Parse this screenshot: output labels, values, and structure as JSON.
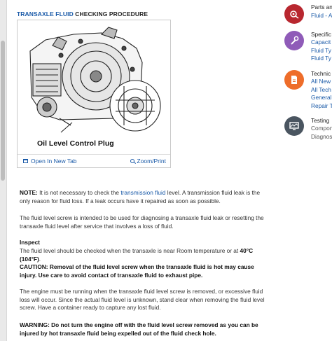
{
  "procedure": {
    "title_link": "TRANSAXLE FLUID",
    "title_rest": " CHECKING PROCEDURE"
  },
  "figure": {
    "caption": "Oil Level Control Plug",
    "open_label": "Open In New Tab",
    "zoom_label": "Zoom/Print"
  },
  "content": {
    "note_label": "NOTE:",
    "note_pre": " It is not necessary to check the ",
    "note_link": "transmission fluid",
    "note_post": " level. A transmission fluid leak is the only reason for fluid loss. If a leak occurs have it repaired as soon as possible.",
    "p2": "The fluid level screw is intended to be used for diagnosing a transaxle fluid leak or resetting the transaxle fluid level after service that involves a loss of fluid.",
    "inspect_heading": "Inspect",
    "inspect_pre": "The fluid level should be checked when the transaxle is near Room temperature or at ",
    "inspect_temp": "40°C (104°F)",
    "inspect_post": ".",
    "caution": "CAUTION: Removal of the fluid level screw when the transaxle fluid is hot may cause injury. Use care to avoid contact of transaxle fluid to exhaust pipe.",
    "p4": "The engine must be running when the transaxle fluid level screw is removed, or excessive fluid loss will occur. Since the actual fluid level is unknown, stand clear when removing the fluid level screw. Have a container ready to capture any lost fluid.",
    "warning": "WARNING: Do not turn the engine off with the fluid level screw removed as you can be injured by hot transaxle fluid being expelled out of the fluid check hole."
  },
  "sidebar": {
    "parts": {
      "heading": "Parts and",
      "links": [
        "Fluid - A"
      ]
    },
    "specs": {
      "heading": "Specific",
      "links": [
        "Capacit",
        "Fluid Ty",
        "Fluid Ty"
      ]
    },
    "tech": {
      "heading": "Technic",
      "links": [
        "All New",
        "All Tech",
        "General",
        "Repair T"
      ]
    },
    "testing": {
      "heading": "Testing",
      "texts": [
        "Compon",
        "Diagnos"
      ]
    }
  },
  "colors": {
    "link": "#1a5aa8",
    "parts_circle": "#b8272f",
    "specs_circle": "#8f5bb8",
    "tech_circle": "#ee6d2a",
    "testing_circle": "#4a5560"
  },
  "icons": {
    "parts": "gear-wrench-icon",
    "specs": "wrench-icon",
    "tech": "document-icon",
    "testing": "monitor-icon",
    "open": "new-tab-icon",
    "zoom": "magnifier-icon"
  }
}
